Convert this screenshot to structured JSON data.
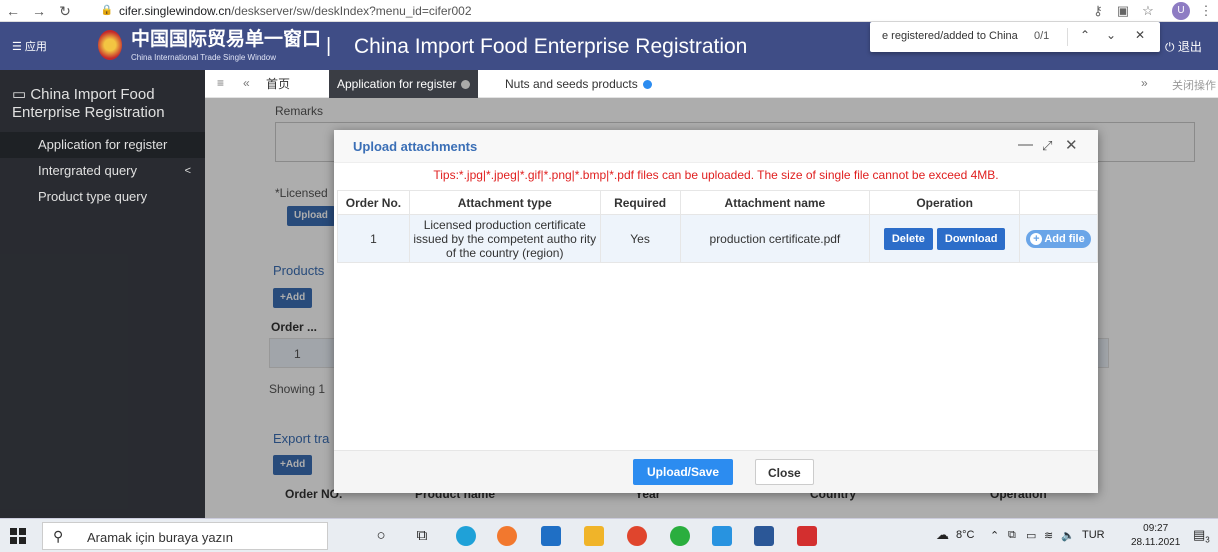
{
  "browser": {
    "url_host": "cifer.singlewindow.cn",
    "url_path": "/deskserver/sw/deskIndex?menu_id=cifer002",
    "profile_initial": "U"
  },
  "header": {
    "menu_label": "应用",
    "logo_cn": "中国国际贸易单一窗口",
    "logo_en": "China International Trade Single Window",
    "separator": "|",
    "title": "China Import Food Enterprise Registration",
    "logout": "退出"
  },
  "findbar": {
    "text": "e registered/added to China",
    "count": "0/1"
  },
  "sidebar": {
    "title": "China Import Food Enterprise Registration",
    "collapse": "<",
    "items": [
      {
        "label": "Application for register"
      },
      {
        "label": "Intergrated query",
        "caret": "<"
      },
      {
        "label": "Product type query"
      }
    ]
  },
  "tabs": {
    "items": [
      {
        "label": "首页"
      },
      {
        "label": "Application for register"
      },
      {
        "label": "Nuts and seeds products"
      }
    ],
    "close_ops": "关闭操作"
  },
  "background": {
    "remarks": "Remarks",
    "licensed": "*Licensed",
    "upload": "Upload",
    "products": "Products",
    "add": "+Add",
    "order": "Order ...",
    "row_num": "1",
    "showing": "Showing 1",
    "export": "Export tra",
    "add2": "+Add",
    "order_no": "Order NO.",
    "product_name": "Product name",
    "year": "Year",
    "country": "Country",
    "operation": "Operation"
  },
  "modal": {
    "title": "Upload attachments",
    "tips": "Tips:*.jpg|*.jpeg|*.gif|*.png|*.bmp|*.pdf files can be uploaded. The size of single file cannot be exceed 4MB.",
    "columns": [
      "Order No.",
      "Attachment type",
      "Required",
      "Attachment name",
      "Operation"
    ],
    "rows": [
      {
        "order": "1",
        "type": "Licensed production certificate issued by the competent autho rity of the country (region)",
        "required": "Yes",
        "name": "production certificate.pdf",
        "delete": "Delete",
        "download": "Download",
        "add_file": "Add file"
      }
    ],
    "upload_save": "Upload/Save",
    "close": "Close"
  },
  "taskbar": {
    "search_placeholder": "Aramak için buraya yazın",
    "temperature": "8°C",
    "lang": "TUR",
    "time": "09:27",
    "date": "28.11.2021",
    "notif_count": "3"
  }
}
